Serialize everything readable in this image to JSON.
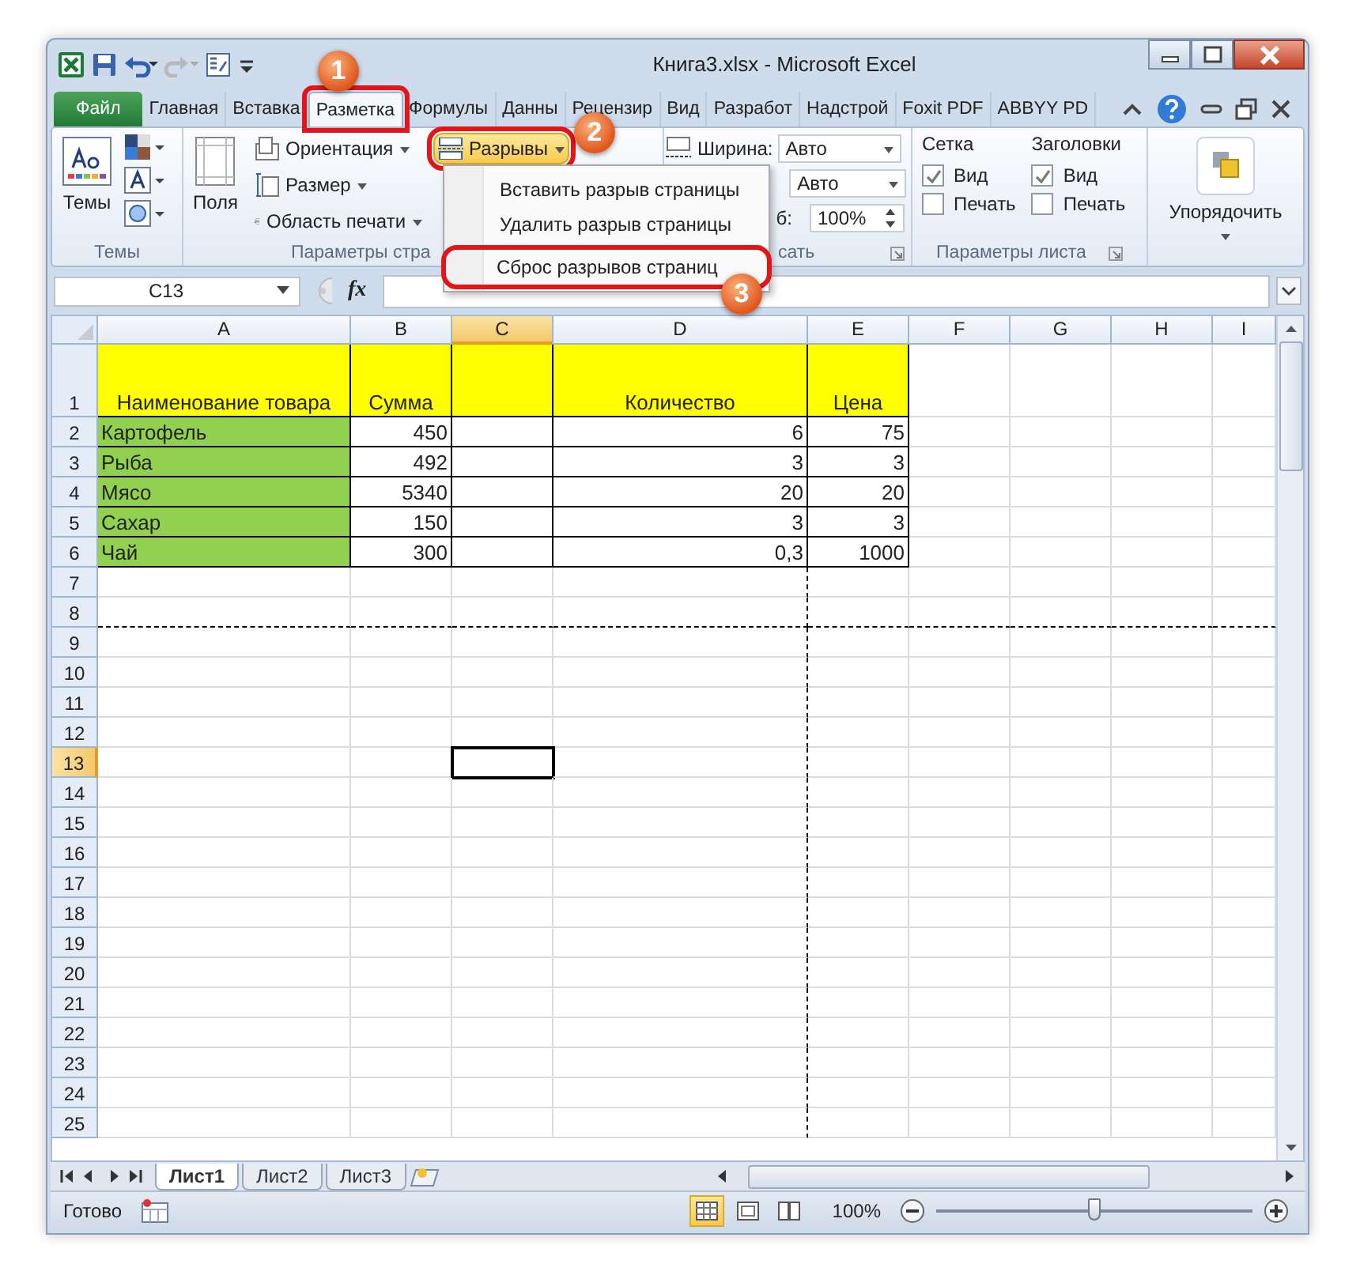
{
  "window": {
    "title": "Книга3.xlsx - Microsoft Excel"
  },
  "ribbon_tabs": [
    {
      "label": "Файл",
      "kind": "file",
      "selected": false
    },
    {
      "label": "Главная",
      "kind": "tab",
      "selected": false
    },
    {
      "label": "Вставка",
      "kind": "tab",
      "selected": false
    },
    {
      "label": "Разметка",
      "kind": "tab",
      "selected": true,
      "callout": "1"
    },
    {
      "label": "Формулы",
      "kind": "tab",
      "selected": false
    },
    {
      "label": "Данны",
      "kind": "tab",
      "selected": false
    },
    {
      "label": "Рецензир",
      "kind": "tab",
      "selected": false
    },
    {
      "label": "Вид",
      "kind": "tab",
      "selected": false
    },
    {
      "label": "Разработ",
      "kind": "tab",
      "selected": false
    },
    {
      "label": "Надстрой",
      "kind": "tab",
      "selected": false
    },
    {
      "label": "Foxit PDF",
      "kind": "tab",
      "selected": false
    },
    {
      "label": "ABBYY PD",
      "kind": "tab",
      "selected": false
    }
  ],
  "ribbon": {
    "themes_group": {
      "button": "Темы",
      "label": "Темы"
    },
    "page_setup_group": {
      "margins": "Поля",
      "orientation": "Ориентация",
      "size": "Размер",
      "print_area": "Область печати",
      "breaks": {
        "label": "Разрывы",
        "selected": true,
        "callout": "2"
      },
      "label": "Параметры стра"
    },
    "fit_group": {
      "width_label": "Ширина:",
      "width": "Авто",
      "height": "Авто",
      "scale_label": "б:",
      "scale": "100%",
      "label": "сать"
    },
    "sheet_options_group": {
      "gridlines": {
        "title": "Сетка",
        "view": {
          "label": "Вид",
          "checked": true
        },
        "print": {
          "label": "Печать",
          "checked": false
        }
      },
      "headings": {
        "title": "Заголовки",
        "view": {
          "label": "Вид",
          "checked": true
        },
        "print": {
          "label": "Печать",
          "checked": false
        }
      },
      "label": "Параметры листа"
    },
    "arrange_group": {
      "button": "Упорядочить"
    }
  },
  "breaks_menu": {
    "items": [
      {
        "label": "Вставить разрыв страницы",
        "selected": false
      },
      {
        "label": "Удалить разрыв страницы",
        "selected": false
      },
      {
        "label": "Сброс разрывов страниц",
        "selected": true,
        "callout": "3"
      }
    ]
  },
  "formula_bar": {
    "name_box": "C13",
    "fx": "fx"
  },
  "sheet": {
    "columns": [
      {
        "label": "A",
        "selected": false,
        "page_break": false
      },
      {
        "label": "B",
        "selected": false,
        "page_break": false
      },
      {
        "label": "C",
        "selected": true,
        "page_break": false
      },
      {
        "label": "D",
        "selected": false,
        "page_break": true
      },
      {
        "label": "E",
        "selected": false,
        "page_break": false
      },
      {
        "label": "F",
        "selected": false,
        "page_break": false
      },
      {
        "label": "G",
        "selected": false,
        "page_break": false
      },
      {
        "label": "H",
        "selected": false,
        "page_break": false
      },
      {
        "label": "I",
        "selected": false,
        "page_break": false
      }
    ],
    "rows": [
      {
        "label": "1",
        "selected": false,
        "page_break": false
      },
      {
        "label": "2",
        "selected": false,
        "page_break": false
      },
      {
        "label": "3",
        "selected": false,
        "page_break": false
      },
      {
        "label": "4",
        "selected": false,
        "page_break": false
      },
      {
        "label": "5",
        "selected": false,
        "page_break": false
      },
      {
        "label": "6",
        "selected": false,
        "page_break": false
      },
      {
        "label": "7",
        "selected": false,
        "page_break": false
      },
      {
        "label": "8",
        "selected": false,
        "page_break": true
      },
      {
        "label": "9",
        "selected": false,
        "page_break": false
      },
      {
        "label": "10",
        "selected": false,
        "page_break": false
      },
      {
        "label": "11",
        "selected": false,
        "page_break": false
      },
      {
        "label": "12",
        "selected": false,
        "page_break": false
      },
      {
        "label": "13",
        "selected": true,
        "page_break": false
      },
      {
        "label": "14",
        "selected": false,
        "page_break": false
      },
      {
        "label": "15",
        "selected": false,
        "page_break": false
      },
      {
        "label": "16",
        "selected": false,
        "page_break": false
      },
      {
        "label": "17",
        "selected": false,
        "page_break": false
      },
      {
        "label": "18",
        "selected": false,
        "page_break": false
      },
      {
        "label": "19",
        "selected": false,
        "page_break": false
      },
      {
        "label": "20",
        "selected": false,
        "page_break": false
      },
      {
        "label": "21",
        "selected": false,
        "page_break": false
      },
      {
        "label": "22",
        "selected": false,
        "page_break": false
      },
      {
        "label": "23",
        "selected": false,
        "page_break": false
      },
      {
        "label": "24",
        "selected": false,
        "page_break": false
      },
      {
        "label": "25",
        "selected": false,
        "page_break": false
      }
    ],
    "table": {
      "header": {
        "name": "Наименование товара",
        "sum": "Сумма",
        "quantity": "Количество",
        "price": "Цена"
      },
      "rows": [
        {
          "name": "Картофель",
          "sum": "450",
          "quantity": "6",
          "price": "75"
        },
        {
          "name": "Рыба",
          "sum": "492",
          "quantity": "3",
          "price": "3"
        },
        {
          "name": "Мясо",
          "sum": "5340",
          "quantity": "20",
          "price": "20"
        },
        {
          "name": "Сахар",
          "sum": "150",
          "quantity": "3",
          "price": "3"
        },
        {
          "name": "Чай",
          "sum": "300",
          "quantity": "0,3",
          "price": "1000"
        }
      ]
    }
  },
  "sheet_tabs": [
    {
      "label": "Лист1",
      "selected": true
    },
    {
      "label": "Лист2",
      "selected": false
    },
    {
      "label": "Лист3",
      "selected": false
    }
  ],
  "status_bar": {
    "status": "Готово",
    "views": [
      {
        "kind": "normal",
        "selected": true
      },
      {
        "kind": "page_layout",
        "selected": false
      },
      {
        "kind": "page_break",
        "selected": false
      }
    ],
    "zoom": "100%",
    "zoom_slider": {
      "level": 0.5
    }
  }
}
